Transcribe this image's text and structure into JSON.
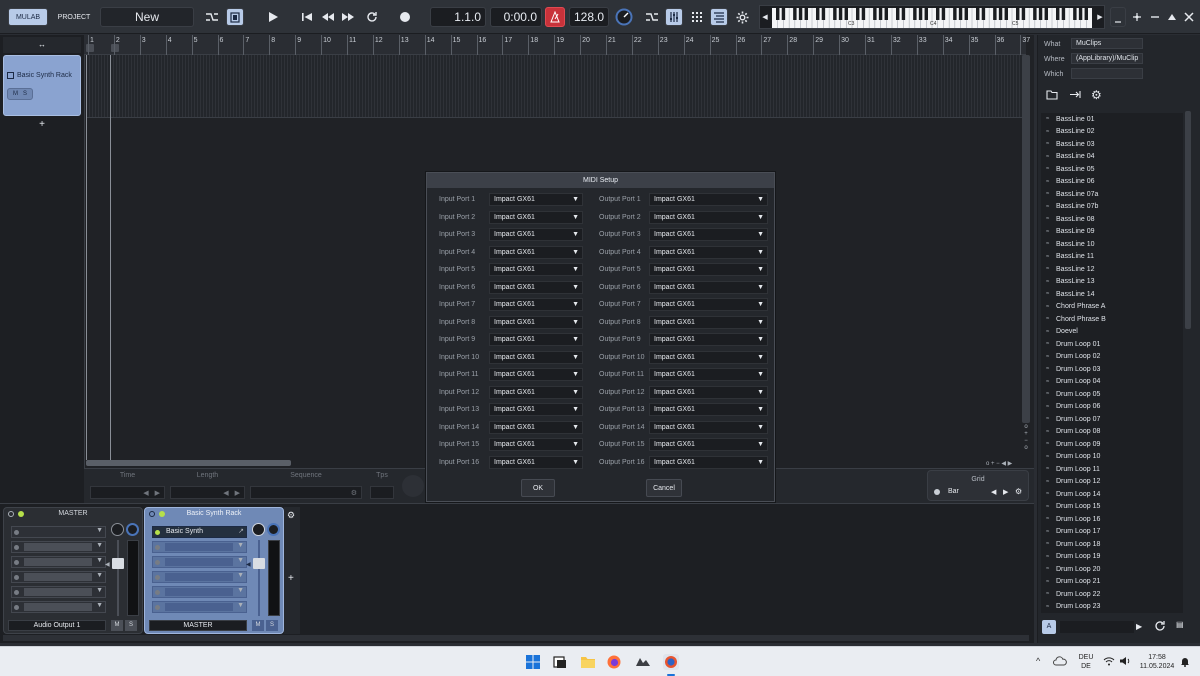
{
  "toolbar": {
    "tab_mulab": "MULAB",
    "tab_project": "PROJECT",
    "project_name": "New",
    "position": "1.1.0",
    "time": "0:00.0",
    "tempo": "128.0",
    "piano_labels": [
      "C3",
      "C4",
      "C5"
    ]
  },
  "track": {
    "name": "Basic Synth Rack",
    "mute": "M",
    "solo": "S",
    "add": "+",
    "resize": "↔"
  },
  "ruler": [
    "1",
    "2",
    "3",
    "4",
    "5",
    "6",
    "7",
    "8",
    "9",
    "10",
    "11",
    "12",
    "13",
    "14",
    "15",
    "16",
    "17",
    "18",
    "19",
    "20",
    "21",
    "22",
    "23",
    "24",
    "25",
    "26",
    "27",
    "28",
    "29",
    "30",
    "31",
    "32",
    "33",
    "34",
    "35",
    "36",
    "37"
  ],
  "inspector": {
    "time_label": "Time",
    "length_label": "Length",
    "sequence_label": "Sequence",
    "tps_label": "Tps",
    "grid_label": "Grid",
    "grid_value": "Bar"
  },
  "mixer": {
    "master": {
      "title": "MASTER",
      "output": "Audio Output 1",
      "mute": "M",
      "solo": "S"
    },
    "rack": {
      "title": "Basic Synth Rack",
      "slot1": "Basic Synth",
      "output": "MASTER",
      "mute": "M",
      "solo": "S"
    },
    "add": "+"
  },
  "browser": {
    "what_label": "What",
    "what_value": "MuClips",
    "where_label": "Where",
    "where_value": "(AppLibrary)/MuClip",
    "which_label": "Which",
    "which_value": "",
    "items": [
      "BassLine 01",
      "BassLine 02",
      "BassLine 03",
      "BassLine 04",
      "BassLine 05",
      "BassLine 06",
      "BassLine 07a",
      "BassLine 07b",
      "BassLine 08",
      "BassLine 09",
      "BassLine 10",
      "BassLine 11",
      "BassLine 12",
      "BassLine 13",
      "BassLine 14",
      "Chord Phrase A",
      "Chord Phrase B",
      "Doevel",
      "Drum Loop 01",
      "Drum Loop 02",
      "Drum Loop 03",
      "Drum Loop 04",
      "Drum Loop 05",
      "Drum Loop 06",
      "Drum Loop 07",
      "Drum Loop 08",
      "Drum Loop 09",
      "Drum Loop 10",
      "Drum Loop 11",
      "Drum Loop 12",
      "Drum Loop 14",
      "Drum Loop 15",
      "Drum Loop 16",
      "Drum Loop 17",
      "Drum Loop 18",
      "Drum Loop 19",
      "Drum Loop 20",
      "Drum Loop 21",
      "Drum Loop 22",
      "Drum Loop 23"
    ],
    "audition_button": "A"
  },
  "dialog": {
    "title": "MIDI Setup",
    "ports": [
      {
        "in_label": "Input Port 1",
        "in_value": "Impact GX61",
        "out_label": "Output Port 1",
        "out_value": "Impact GX61"
      },
      {
        "in_label": "Input Port 2",
        "in_value": "Impact GX61",
        "out_label": "Output Port 2",
        "out_value": "Impact GX61"
      },
      {
        "in_label": "Input Port 3",
        "in_value": "Impact GX61",
        "out_label": "Output Port 3",
        "out_value": "Impact GX61"
      },
      {
        "in_label": "Input Port 4",
        "in_value": "Impact GX61",
        "out_label": "Output Port 4",
        "out_value": "Impact GX61"
      },
      {
        "in_label": "Input Port 5",
        "in_value": "Impact GX61",
        "out_label": "Output Port 5",
        "out_value": "Impact GX61"
      },
      {
        "in_label": "Input Port 6",
        "in_value": "Impact GX61",
        "out_label": "Output Port 6",
        "out_value": "Impact GX61"
      },
      {
        "in_label": "Input Port 7",
        "in_value": "Impact GX61",
        "out_label": "Output Port 7",
        "out_value": "Impact GX61"
      },
      {
        "in_label": "Input Port 8",
        "in_value": "Impact GX61",
        "out_label": "Output Port 8",
        "out_value": "Impact GX61"
      },
      {
        "in_label": "Input Port 9",
        "in_value": "Impact GX61",
        "out_label": "Output Port 9",
        "out_value": "Impact GX61"
      },
      {
        "in_label": "Input Port 10",
        "in_value": "Impact GX61",
        "out_label": "Output Port 10",
        "out_value": "Impact GX61"
      },
      {
        "in_label": "Input Port 11",
        "in_value": "Impact GX61",
        "out_label": "Output Port 11",
        "out_value": "Impact GX61"
      },
      {
        "in_label": "Input Port 12",
        "in_value": "Impact GX61",
        "out_label": "Output Port 12",
        "out_value": "Impact GX61"
      },
      {
        "in_label": "Input Port 13",
        "in_value": "Impact GX61",
        "out_label": "Output Port 13",
        "out_value": "Impact GX61"
      },
      {
        "in_label": "Input Port 14",
        "in_value": "Impact GX61",
        "out_label": "Output Port 14",
        "out_value": "Impact GX61"
      },
      {
        "in_label": "Input Port 15",
        "in_value": "Impact GX61",
        "out_label": "Output Port 15",
        "out_value": "Impact GX61"
      },
      {
        "in_label": "Input Port 16",
        "in_value": "Impact GX61",
        "out_label": "Output Port 16",
        "out_value": "Impact GX61"
      }
    ],
    "ok_label": "OK",
    "cancel_label": "Cancel"
  },
  "taskbar": {
    "lang_top": "DEU",
    "lang_bottom": "DE",
    "time": "17:58",
    "date": "11.05.2024"
  },
  "colors": {
    "accent_active": "#b8cbe8",
    "track_header": "#8aa3d0",
    "record_red": "#c8323a",
    "led_green": "#b6e04a"
  }
}
